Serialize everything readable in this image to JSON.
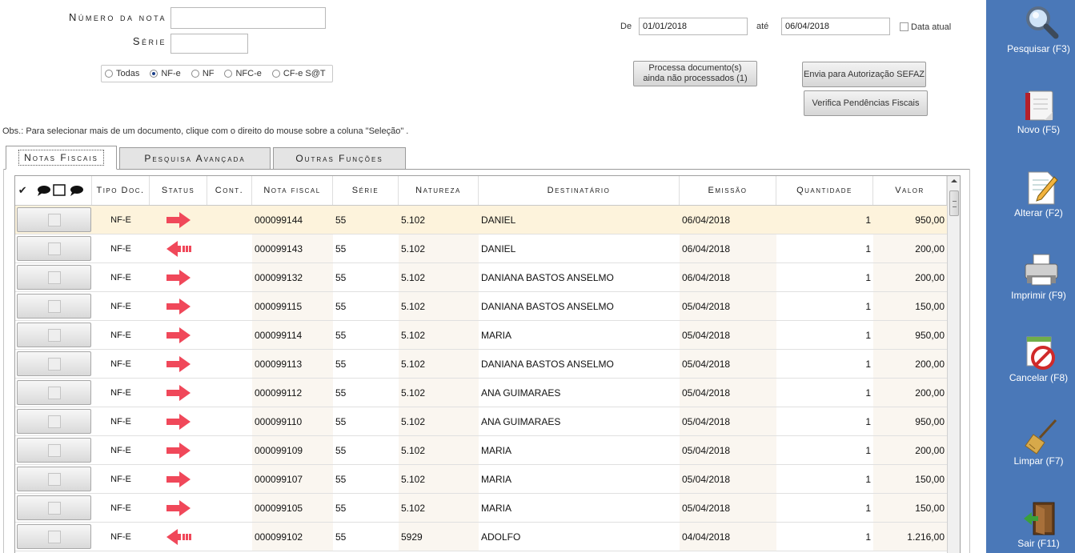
{
  "form": {
    "numero_label": "Número da nota",
    "serie_label": "Série",
    "numero_value": "",
    "serie_value": "",
    "radio_options": [
      {
        "label": "Todas",
        "checked": false
      },
      {
        "label": "NF-e",
        "checked": true
      },
      {
        "label": "NF",
        "checked": false
      },
      {
        "label": "NFC-e",
        "checked": false
      },
      {
        "label": "CF-e S@T",
        "checked": false
      }
    ],
    "de_label": "De",
    "ate_label": "até",
    "date_from": "01/01/2018",
    "date_to": "06/04/2018",
    "data_atual_label": "Data atual",
    "data_atual_checked": false
  },
  "actions": {
    "processa_label": "Processa documento(s) ainda não processados (1)",
    "envia_label": "Envia para Autorização SEFAZ",
    "verifica_label": "Verifica Pendências Fiscais"
  },
  "obs_text": "Obs.: Para selecionar mais de um documento, clique com o direito do mouse sobre a coluna \"Seleção\" .",
  "tabs": [
    {
      "label": "Notas Fiscais",
      "active": true
    },
    {
      "label": "Pesquisa Avançada",
      "active": false
    },
    {
      "label": "Outras Funções",
      "active": false
    }
  ],
  "grid": {
    "header_check": "✔",
    "columns": [
      "Tipo Doc.",
      "Status",
      "Cont.",
      "Nota fiscal",
      "Série",
      "Natureza",
      "Destinatário",
      "Emissão",
      "Quantidade",
      "Valor"
    ],
    "rows": [
      {
        "tipo": "NF-E",
        "status": "right",
        "nota": "000099144",
        "serie": "55",
        "natureza": "5.102",
        "destinatario": "DANIEL",
        "emissao": "06/04/2018",
        "quantidade": "1",
        "valor": "950,00",
        "selected": true
      },
      {
        "tipo": "NF-E",
        "status": "left",
        "nota": "000099143",
        "serie": "55",
        "natureza": "5.102",
        "destinatario": "DANIEL",
        "emissao": "06/04/2018",
        "quantidade": "1",
        "valor": "200,00",
        "selected": false
      },
      {
        "tipo": "NF-E",
        "status": "right",
        "nota": "000099132",
        "serie": "55",
        "natureza": "5.102",
        "destinatario": "DANIANA BASTOS ANSELMO",
        "emissao": "06/04/2018",
        "quantidade": "1",
        "valor": "200,00",
        "selected": false
      },
      {
        "tipo": "NF-E",
        "status": "right",
        "nota": "000099115",
        "serie": "55",
        "natureza": "5.102",
        "destinatario": "DANIANA BASTOS ANSELMO",
        "emissao": "05/04/2018",
        "quantidade": "1",
        "valor": "150,00",
        "selected": false
      },
      {
        "tipo": "NF-E",
        "status": "right",
        "nota": "000099114",
        "serie": "55",
        "natureza": "5.102",
        "destinatario": "MARIA",
        "emissao": "05/04/2018",
        "quantidade": "1",
        "valor": "950,00",
        "selected": false
      },
      {
        "tipo": "NF-E",
        "status": "right",
        "nota": "000099113",
        "serie": "55",
        "natureza": "5.102",
        "destinatario": "DANIANA BASTOS ANSELMO",
        "emissao": "05/04/2018",
        "quantidade": "1",
        "valor": "200,00",
        "selected": false
      },
      {
        "tipo": "NF-E",
        "status": "right",
        "nota": "000099112",
        "serie": "55",
        "natureza": "5.102",
        "destinatario": "ANA  GUIMARAES",
        "emissao": "05/04/2018",
        "quantidade": "1",
        "valor": "200,00",
        "selected": false
      },
      {
        "tipo": "NF-E",
        "status": "right",
        "nota": "000099110",
        "serie": "55",
        "natureza": "5.102",
        "destinatario": "ANA  GUIMARAES",
        "emissao": "05/04/2018",
        "quantidade": "1",
        "valor": "950,00",
        "selected": false
      },
      {
        "tipo": "NF-E",
        "status": "right",
        "nota": "000099109",
        "serie": "55",
        "natureza": "5.102",
        "destinatario": "MARIA",
        "emissao": "05/04/2018",
        "quantidade": "1",
        "valor": "200,00",
        "selected": false
      },
      {
        "tipo": "NF-E",
        "status": "right",
        "nota": "000099107",
        "serie": "55",
        "natureza": "5.102",
        "destinatario": "MARIA",
        "emissao": "05/04/2018",
        "quantidade": "1",
        "valor": "150,00",
        "selected": false
      },
      {
        "tipo": "NF-E",
        "status": "right",
        "nota": "000099105",
        "serie": "55",
        "natureza": "5.102",
        "destinatario": "MARIA",
        "emissao": "05/04/2018",
        "quantidade": "1",
        "valor": "150,00",
        "selected": false
      },
      {
        "tipo": "NF-E",
        "status": "left",
        "nota": "000099102",
        "serie": "55",
        "natureza": "5929",
        "destinatario": "ADOLFO",
        "emissao": "04/04/2018",
        "quantidade": "1",
        "valor": "1.216,00",
        "selected": false
      }
    ]
  },
  "sidebar": {
    "buttons": [
      {
        "label": "Pesquisar (F3)",
        "icon": "magnifier-icon"
      },
      {
        "label": "Novo (F5)",
        "icon": "new-document-icon"
      },
      {
        "label": "Alterar (F2)",
        "icon": "edit-document-icon"
      },
      {
        "label": "Imprimir (F9)",
        "icon": "printer-icon"
      },
      {
        "label": "Cancelar (F8)",
        "icon": "cancel-icon"
      },
      {
        "label": "Limpar (F7)",
        "icon": "broom-icon"
      },
      {
        "label": "Sair (F11)",
        "icon": "exit-door-icon"
      }
    ]
  },
  "colors": {
    "sidebar_bg": "#4a78b8",
    "selected_row": "#fdf3dc",
    "status_arrow": "#f0485a"
  }
}
